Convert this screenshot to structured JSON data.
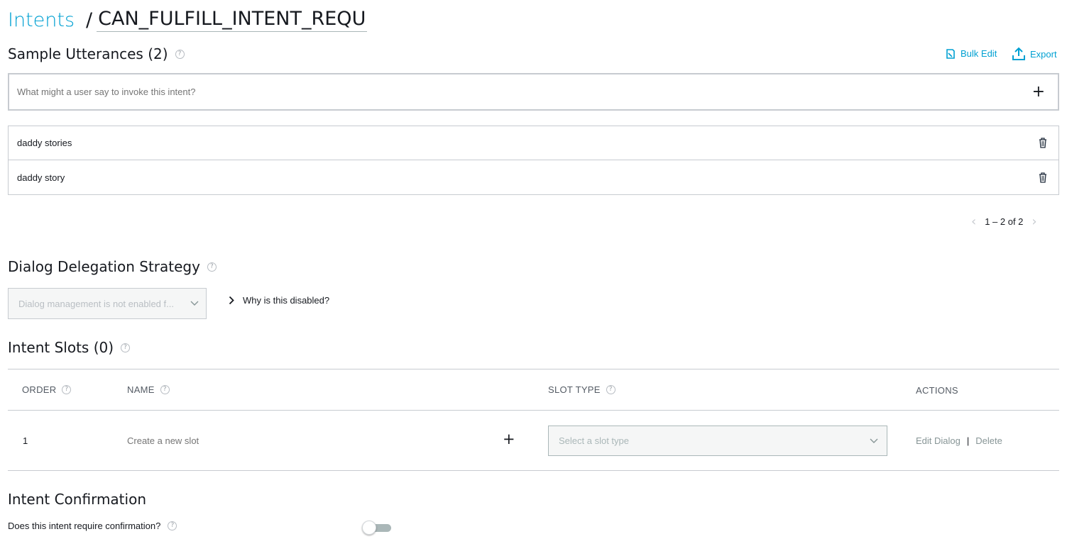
{
  "breadcrumb": {
    "parent": "Intents",
    "separator": "/",
    "current": "CAN_FULFILL_INTENT_REQU"
  },
  "utterances": {
    "title": "Sample Utterances (2)",
    "bulk_edit": "Bulk Edit",
    "export": "Export",
    "placeholder": "What might a user say to invoke this intent?",
    "items": [
      "daddy stories",
      "daddy story"
    ],
    "pagination": "1 – 2 of 2"
  },
  "dialog": {
    "title": "Dialog Delegation Strategy",
    "select_value": "Dialog management is not enabled f...",
    "why_disabled": "Why is this disabled?"
  },
  "slots": {
    "title": "Intent Slots (0)",
    "columns": {
      "order": "ORDER",
      "name": "NAME",
      "slot_type": "SLOT TYPE",
      "actions": "ACTIONS"
    },
    "row": {
      "order": "1",
      "name_placeholder": "Create a new slot",
      "type_placeholder": "Select a slot type",
      "edit_dialog": "Edit Dialog",
      "separator": "|",
      "delete": "Delete"
    }
  },
  "confirmation": {
    "title": "Intent Confirmation",
    "question": "Does this intent require confirmation?",
    "enabled": false
  },
  "help_glyph": "?",
  "colors": {
    "accent": "#00a0d2",
    "text": "#16191f",
    "muted": "#879596",
    "border": "#c7cbd0"
  }
}
